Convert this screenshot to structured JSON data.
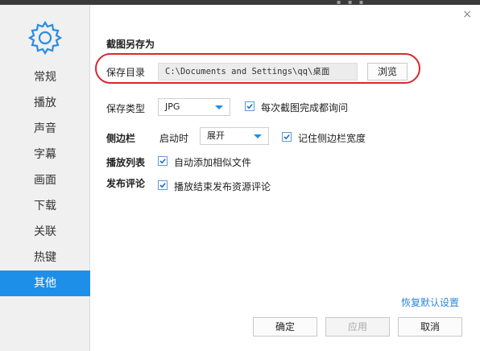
{
  "sidebar": {
    "items": [
      {
        "label": "常规",
        "active": false
      },
      {
        "label": "播放",
        "active": false
      },
      {
        "label": "声音",
        "active": false
      },
      {
        "label": "字幕",
        "active": false
      },
      {
        "label": "画面",
        "active": false
      },
      {
        "label": "下载",
        "active": false
      },
      {
        "label": "关联",
        "active": false
      },
      {
        "label": "热键",
        "active": false
      },
      {
        "label": "其他",
        "active": true
      }
    ]
  },
  "dialog": {
    "close_symbol": "×"
  },
  "screenshot": {
    "section_title": "截图另存为",
    "dir_label": "保存目录",
    "dir_value": "C:\\Documents and Settings\\qq\\桌面",
    "browse_label": "浏览",
    "type_label": "保存类型",
    "type_value": "JPG",
    "ask_each_label": "每次截图完成都询问",
    "ask_each_checked": true
  },
  "sidebar_settings": {
    "label": "侧边栏",
    "startup_label": "启动时",
    "startup_value": "展开",
    "remember_width_label": "记住侧边栏宽度",
    "remember_width_checked": true
  },
  "playlist": {
    "label": "播放列表",
    "auto_add_label": "自动添加相似文件",
    "auto_add_checked": true
  },
  "review": {
    "label": "发布评论",
    "review_after_label": "播放结束发布资源评论",
    "review_after_checked": true
  },
  "footer": {
    "restore_defaults": "恢复默认设置",
    "ok": "确定",
    "apply": "应用",
    "cancel": "取消"
  },
  "colors": {
    "accent": "#1e8fe8",
    "highlight_oval": "#d8282f",
    "link": "#2c88d9"
  }
}
